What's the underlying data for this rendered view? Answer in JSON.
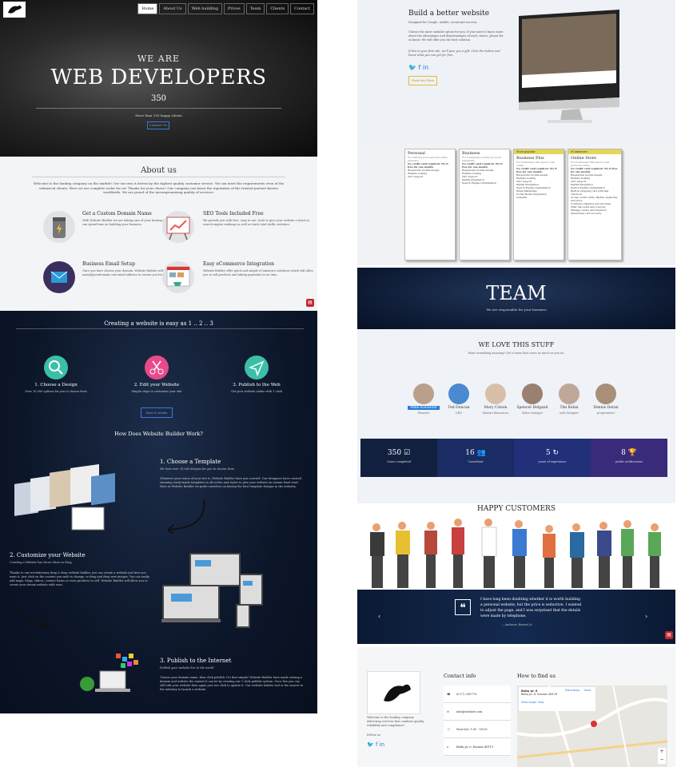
{
  "hero": {
    "nav": [
      "Home",
      "About Us",
      "Web building",
      "Prices",
      "Team",
      "Clients",
      "Contact"
    ],
    "we_are": "WE ARE",
    "title": "WEB DEVELOPERS",
    "count": "350",
    "sub": "More than 350 happy clients",
    "cta": "Contact Us"
  },
  "about": {
    "title": "About us",
    "intro": "Welcome to the leading company on the market! Our success is driven by the highest quality customer service. We can meet the requirements even of the whimsical clients. Here we are complete order for us! Thanks for your choice! Our company can boast the reputation of the trusted partner known worldwide. We are proud of the uncompromising quality of services.",
    "features": [
      {
        "title": "Get a Custom Domain Name",
        "desc": "With Website Builder we are taking care of your hosting and domain, so you can spend time on building your business."
      },
      {
        "title": "SEO Tools Included Free",
        "desc": "We provide you with free, easy to use, tools to give your website a boost in search engine rankings as well as track vital traffic statistics."
      },
      {
        "title": "Business Email Setup",
        "desc": "Once you have chosen your domain, Website Builder will help you create name@yourdomain.com email address to ensure you look professional."
      },
      {
        "title": "Easy eCommerce Integration",
        "desc": "Website Builder offer quick and simple eCommerce solutions which will allow you to sell products and taking payments in no time."
      }
    ]
  },
  "steps": {
    "heading": "Creating a website is easy as 1 .. 2 .. 3",
    "items": [
      {
        "title": "1. Choose a Design",
        "desc": "Over 10,000 options for you to choose from"
      },
      {
        "title": "2. Edit your Website",
        "desc": "Simple steps to customize your site"
      },
      {
        "title": "3. Publish to the Web",
        "desc": "Get your website online with 1 click"
      }
    ],
    "button": "How it works",
    "how_title": "How Does Website Builder Work?",
    "blocks": [
      {
        "title": "1. Choose a Template",
        "sub": "We have over 10,000 designs for you to choose from",
        "desc": "Whatever your vision of your site is, Website Builder have you covered. Our designers have created stunning ready-made templates in all niches and styles to give your website an instant head start. Here at Website Builder we pride ourselves on having the best template designs in the industry."
      },
      {
        "title": "2. Customize your Website",
        "sub": "Creating a Website has Never Been so Easy",
        "desc": "Thanks to our revolutionary drag & drop website builder, you can create a website just how you want it. Just click on the content you wish to change, or drag and drop new images. You can easily add maps, blogs, videos, contact forms or even products to sell. Website Builder will allow you to create your dream website with ease."
      },
      {
        "title": "3. Publish to the Internet",
        "sub": "Publish your website live to the world",
        "desc": "Choose your domain name, then click publish. It's that simple! Website Builder have made owning a domain and website the easiest it can be by creating our 1 click publish system. Once live you can still edit your website then again just one click to update it. Our website builder tool is the easiest in the industry to launch a website."
      }
    ]
  },
  "build": {
    "title": "Build a better website",
    "p1": "Designed for Google, mobile, social and success.",
    "p2": "Choose the most suitable option for you. If you want to know more about the advantages and disadvantages of each choice, please let us know. We will offer you the best solution.",
    "p3": "If this is your first site, we'll give you a gift. Click the button and know what you can get for free.",
    "button": "Start for Free"
  },
  "pricing": [
    {
      "tag": "",
      "name": "Personal",
      "sub": "For sharing your personal online presence",
      "lines": [
        "No credit card required. Try it free for one month.",
        "Responsive mobile design",
        "Website hosting",
        "24/7 support"
      ]
    },
    {
      "tag": "",
      "name": "Business",
      "sub": "For businesses looking for more marketing",
      "lines": [
        "No credit card required. Try it free for one month.",
        "Responsive mobile design",
        "Website hosting",
        "24/7 support",
        "PayPal integration",
        "Search Engine Optimization"
      ]
    },
    {
      "tag": "Most popular",
      "name": "Business Plus",
      "sub": "For businesses that need to sell online",
      "lines": [
        "No credit card required. Try it free for one month.",
        "Responsive mobile design",
        "Website hosting",
        "24/7 support",
        "PayPal integration",
        "Search Engine Optimization",
        "Email Marketing",
        "Social Media Integration",
        "Linkedin"
      ]
    },
    {
      "tag": "eCommerce",
      "name": "Online Store",
      "sub": "For businesses that need to sell products online",
      "lines": [
        "No credit card required. Try it free for one month.",
        "Responsive mobile design",
        "Website hosting",
        "24/7 support",
        "PayPal integration",
        "Search Engine Optimization",
        "Built-in shopping cart with fast checkout",
        "Accept credit cards, PayPal, Apple Pay and more",
        "Configure shipping and tax rates",
        "Offer discounts and coupons",
        "Manage orders and inventory",
        "Abandoned cart recovery"
      ]
    }
  ],
  "team": {
    "title": "TEAM",
    "sub": "We are responsible for your business"
  },
  "love": {
    "title": "WE LOVE THIS STUFF",
    "sub": "Want something amazing? Get a team that cares as much as you do.",
    "members": [
      {
        "name": "Mike Kalundar",
        "role": "Founder"
      },
      {
        "name": "Ted Duncan",
        "role": "CEO"
      },
      {
        "name": "Mary Colson",
        "role": "Human Resources"
      },
      {
        "name": "Spencer Belgand",
        "role": "Sales manager"
      },
      {
        "name": "Tim Kelan",
        "role": "web designer"
      },
      {
        "name": "Dennis Deran",
        "role": "programmer"
      }
    ],
    "stats": [
      {
        "num": "350",
        "icon": "☑",
        "label": "Cases completed",
        "color": "#12203f"
      },
      {
        "num": "16",
        "icon": "👥",
        "label": "Consultant",
        "color": "#1a2c63"
      },
      {
        "num": "5",
        "icon": "↻",
        "label": "years of experience",
        "color": "#22307a"
      },
      {
        "num": "8",
        "icon": "🏆",
        "label": "public notifications",
        "color": "#3a2a7a"
      }
    ]
  },
  "customers": {
    "title": "HAPPY CUSTOMERS",
    "quote": "I have long been doubting whether it is worth building a personal website, but the price is seductive. I wanted to adjust the page, and I was surprised that the details were made by telephone.",
    "author": "— Ambrose Bennet Jr."
  },
  "footer": {
    "desc": "Welcome to the leading company delivering services that combine quality, reliability and compliance!",
    "follow": "Follow us",
    "contact_title": "Contact info",
    "phone": "(8 17) 390778",
    "email": "info@website.com",
    "hours": "Mon-Sat: 9:00 - 18:00",
    "address": "Baltų pr. 6, Kaunas 48119",
    "map_title": "How to find us",
    "map_place": "Baltų pr. 6",
    "map_addr": "Baltų pr. 6, Kaunas 48119",
    "directions": "Directions",
    "save": "Save",
    "larger": "View larger map"
  }
}
